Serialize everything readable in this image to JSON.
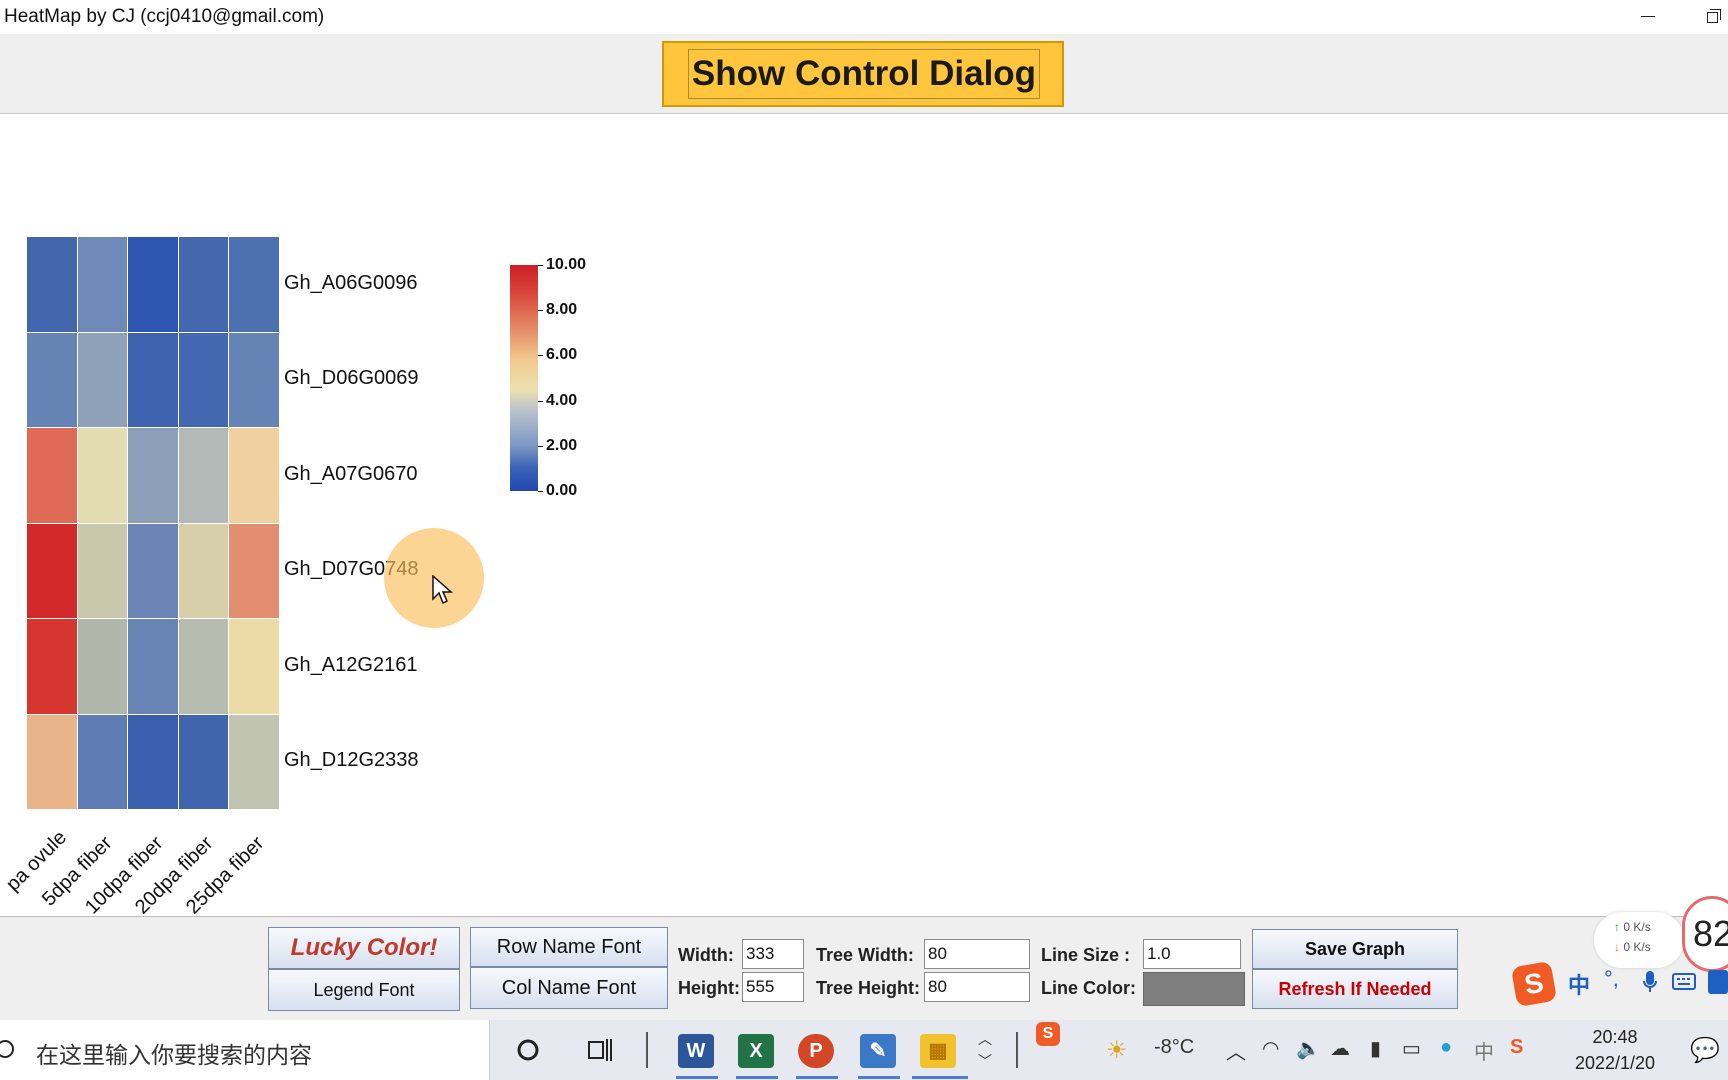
{
  "window": {
    "title": "HeatMap by CJ (ccj0410@gmail.com)"
  },
  "toolbar": {
    "show_control_label": "Show Control Dialog"
  },
  "heatmap": {
    "row_names": [
      "Gh_A06G0096",
      "Gh_D06G0069",
      "Gh_A07G0670",
      "Gh_D07G0748",
      "Gh_A12G2161",
      "Gh_D12G2338"
    ],
    "col_names": [
      "pa ovule",
      "5dpa fiber",
      "10dpa fiber",
      "20dpa fiber",
      "25dpa fiber"
    ],
    "cell_colors": [
      [
        "#4466ac",
        "#6f8ab8",
        "#2e56b0",
        "#4467ae",
        "#4e6fb0"
      ],
      [
        "#6683b5",
        "#8fa1b8",
        "#3f62ae",
        "#4367b0",
        "#6683b6"
      ],
      [
        "#e06a55",
        "#e2dcb0",
        "#8d9fb8",
        "#b3b9b6",
        "#efd09e"
      ],
      [
        "#d22a2a",
        "#c9c8ac",
        "#6c85b6",
        "#d6cfaa",
        "#e38e70"
      ],
      [
        "#d6362f",
        "#b1b6ab",
        "#6884b5",
        "#b7bcb0",
        "#eddba7"
      ],
      [
        "#eab48a",
        "#5f7db4",
        "#3a5fae",
        "#4164ae",
        "#bfc3b0"
      ]
    ],
    "legend": {
      "ticks": [
        "10.00",
        "8.00",
        "6.00",
        "4.00",
        "2.00",
        "0.00"
      ],
      "max": 10.0,
      "min": 0.0
    }
  },
  "controls": {
    "lucky_color": "Lucky Color!",
    "legend_font": "Legend Font",
    "row_name_font": "Row Name Font",
    "col_name_font": "Col Name Font",
    "width_label": "Width:",
    "width_value": "333",
    "height_label": "Height:",
    "height_value": "555",
    "tree_width_label": "Tree Width:",
    "tree_width_value": "80",
    "tree_height_label": "Tree Height:",
    "tree_height_value": "80",
    "line_size_label": "Line Size :",
    "line_size_value": "1.0",
    "line_color_label": "Line Color:",
    "line_color": "#7f7f7f",
    "save_graph": "Save Graph",
    "refresh": "Refresh If Needed"
  },
  "overlay": {
    "net_up": "0  K/s",
    "net_down": "0  K/s",
    "speed": "82"
  },
  "taskbar": {
    "search_placeholder": "在这里输入你要搜索的内容",
    "apps": [
      "cortana-icon",
      "task-view-icon",
      "word-icon",
      "excel-icon",
      "powerpoint-icon",
      "drawing-app-icon",
      "heatmap-app-icon"
    ],
    "weather": "-8°C",
    "ime_lang": "中",
    "time": "20:48",
    "date": "2022/1/20"
  }
}
